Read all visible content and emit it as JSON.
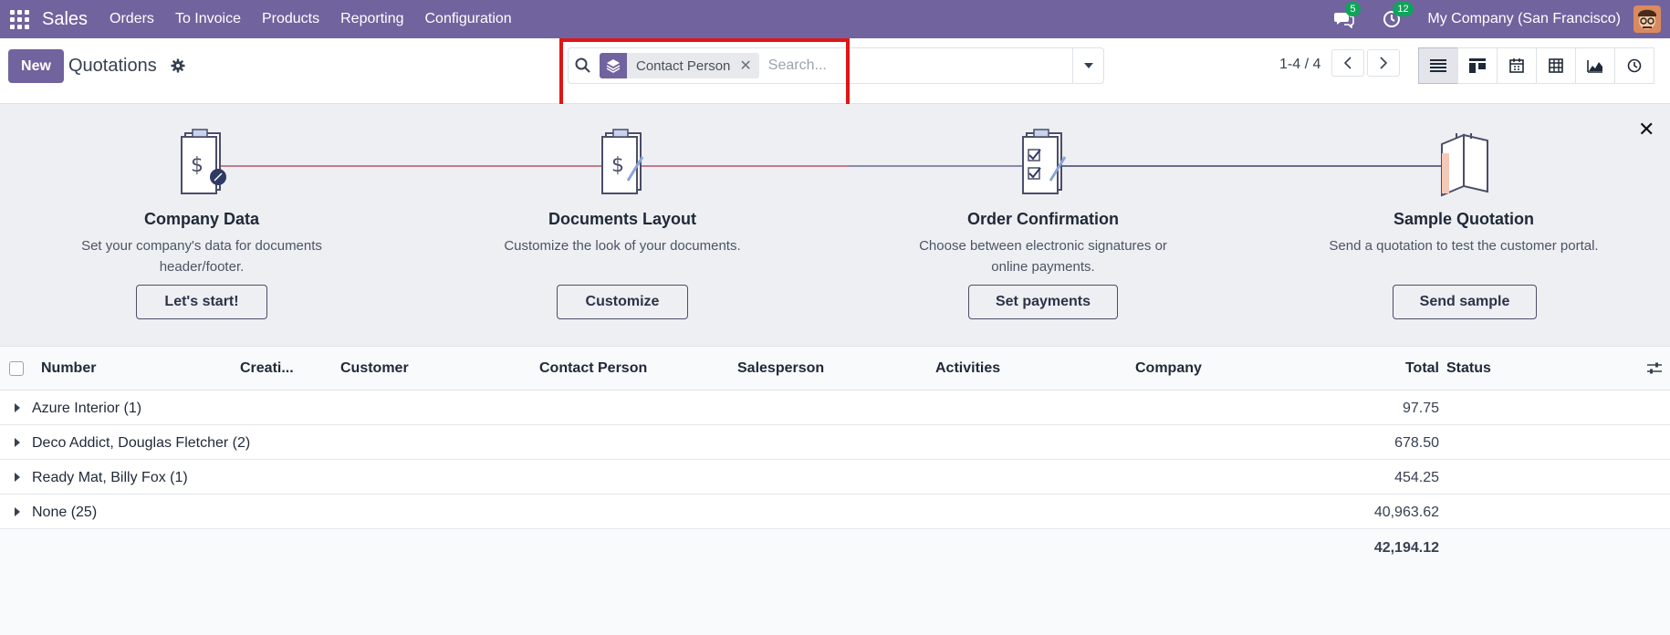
{
  "navbar": {
    "app_name": "Sales",
    "menu": [
      "Orders",
      "To Invoice",
      "Products",
      "Reporting",
      "Configuration"
    ],
    "messages_count": "5",
    "activities_count": "12",
    "company": "My Company (San Francisco)",
    "accent": "#71639e"
  },
  "control": {
    "new_label": "New",
    "title": "Quotations",
    "search": {
      "facet_label": "Contact Person",
      "placeholder": "Search..."
    },
    "pager": "1-4 / 4",
    "views": [
      "list-view-icon",
      "kanban-view-icon",
      "calendar-view-icon",
      "pivot-view-icon",
      "graph-view-icon",
      "activity-view-icon"
    ]
  },
  "onboarding": {
    "steps": [
      {
        "title": "Company Data",
        "desc": "Set your company's data for documents header/footer.",
        "button": "Let's start!"
      },
      {
        "title": "Documents Layout",
        "desc": "Customize the look of your documents.",
        "button": "Customize"
      },
      {
        "title": "Order Confirmation",
        "desc": "Choose between electronic signatures or online payments.",
        "button": "Set payments"
      },
      {
        "title": "Sample Quotation",
        "desc": "Send a quotation to test the customer portal.",
        "button": "Send sample"
      }
    ]
  },
  "table": {
    "headers": [
      "Number",
      "Creati...",
      "Customer",
      "Contact Person",
      "Salesperson",
      "Activities",
      "Company",
      "Total",
      "Status"
    ],
    "groups": [
      {
        "label": "Azure Interior (1)",
        "total": "97.75"
      },
      {
        "label": "Deco Addict, Douglas Fletcher (2)",
        "total": "678.50"
      },
      {
        "label": "Ready Mat, Billy Fox (1)",
        "total": "454.25"
      },
      {
        "label": "None (25)",
        "total": "40,963.62"
      }
    ],
    "grand_total": "42,194.12"
  }
}
